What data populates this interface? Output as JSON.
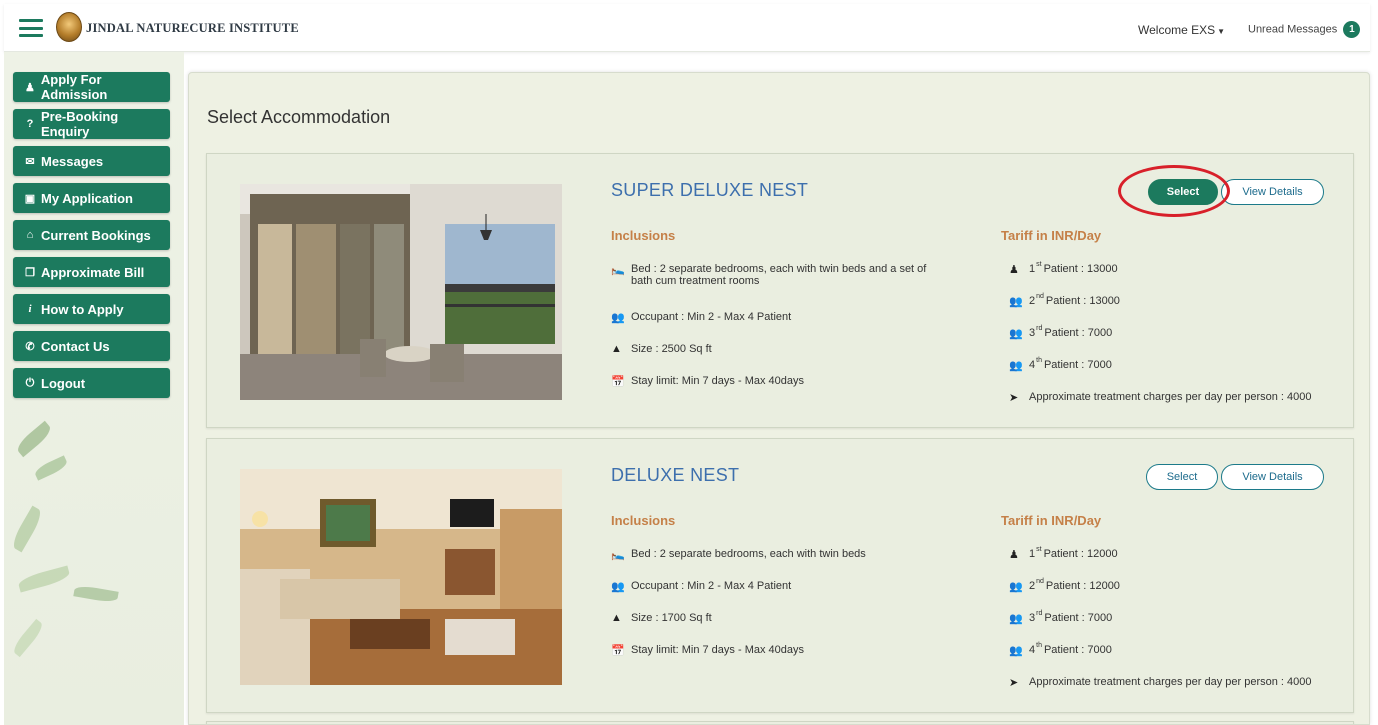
{
  "header": {
    "brand": "JINDAL NATURECURE INSTITUTE",
    "welcome": "Welcome EXS",
    "unread_label": "Unread Messages",
    "unread_count": "1"
  },
  "sidebar": {
    "items": [
      {
        "icon": "user-icon",
        "label": "Apply For Admission"
      },
      {
        "icon": "question-icon",
        "label": "Pre-Booking Enquiry"
      },
      {
        "icon": "envelope-icon",
        "label": "Messages"
      },
      {
        "icon": "file-icon",
        "label": "My Application"
      },
      {
        "icon": "home-icon",
        "label": "Current Bookings"
      },
      {
        "icon": "copy-icon",
        "label": "Approximate Bill"
      },
      {
        "icon": "info-icon",
        "label": "How to Apply"
      },
      {
        "icon": "phone-icon",
        "label": "Contact Us"
      },
      {
        "icon": "power-icon",
        "label": "Logout"
      }
    ]
  },
  "main": {
    "title": "Select Accommodation",
    "inclusions_label": "Inclusions",
    "tariff_label": "Tariff in INR/Day",
    "select_label": "Select",
    "details_label": "View Details",
    "cards": [
      {
        "name": "SUPER DELUXE NEST",
        "bed": "Bed : 2 separate bedrooms, each with twin beds and a set of",
        "bed_line2": "bath cum treatment rooms",
        "occupant": "Occupant : Min  2 - Max 4 Patient",
        "size": "Size : 2500 Sq ft",
        "stay": "Stay limit: Min 7 days - Max 40days",
        "p1": "1",
        "p1_sup": "st",
        "p1_text": "Patient : 13000",
        "p2": "2",
        "p2_sup": "nd",
        "p2_text": "Patient : 13000",
        "p3": "3",
        "p3_sup": "rd",
        "p3_text": "Patient : 7000",
        "p4": "4",
        "p4_sup": "th",
        "p4_text": "Patient : 7000",
        "treatment": "Approximate treatment charges per day per person : 4000"
      },
      {
        "name": "DELUXE NEST",
        "bed": "Bed : 2 separate bedrooms, each with twin beds",
        "occupant": "Occupant : Min  2 - Max 4 Patient",
        "size": "Size : 1700 Sq ft",
        "stay": "Stay limit: Min 7 days - Max 40days",
        "p1": "1",
        "p1_sup": "st",
        "p1_text": "Patient : 12000",
        "p2": "2",
        "p2_sup": "nd",
        "p2_text": "Patient : 12000",
        "p3": "3",
        "p3_sup": "rd",
        "p3_text": "Patient : 7000",
        "p4": "4",
        "p4_sup": "th",
        "p4_text": "Patient : 7000",
        "treatment": "Approximate treatment charges per day per person : 4000"
      }
    ]
  },
  "colors": {
    "accent": "#1c7a5e",
    "title_blue": "#3d6fad",
    "section_orange": "#c58048",
    "annotation_red": "#d8202a"
  }
}
